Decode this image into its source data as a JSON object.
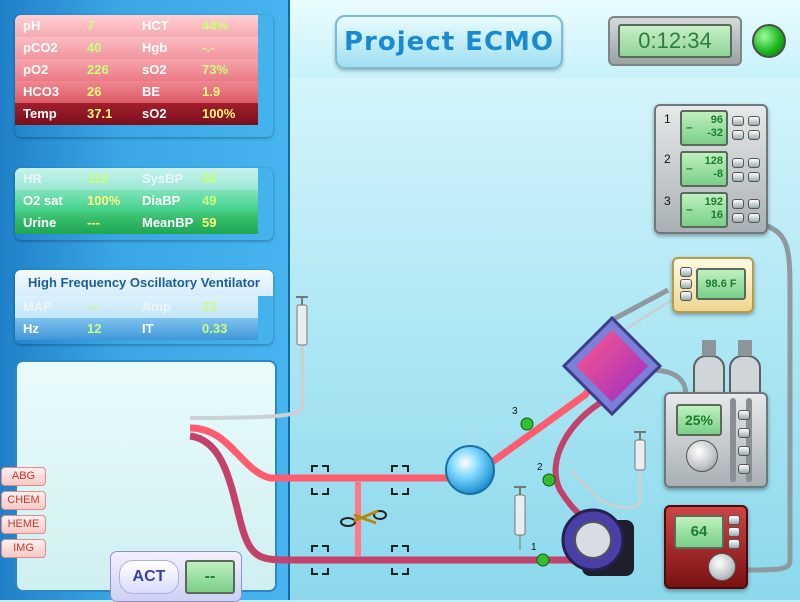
{
  "app": {
    "title": "Project ECMO",
    "timer": "0:12:34"
  },
  "blood_gas": [
    {
      "l1": "pH",
      "v1": "7",
      "l2": "HCT",
      "v2": "44%"
    },
    {
      "l1": "pCO2",
      "v1": "40",
      "l2": "Hgb",
      "v2": "-.-"
    },
    {
      "l1": "pO2",
      "v1": "226",
      "l2": "sO2",
      "v2": "73%"
    },
    {
      "l1": "HCO3",
      "v1": "26",
      "l2": "BE",
      "v2": "1.9"
    },
    {
      "l1": "Temp",
      "v1": "37.1",
      "l2": "sO2",
      "v2": "100%"
    }
  ],
  "vitals": [
    {
      "l1": "HR",
      "v1": "118",
      "l2": "SysBP",
      "v2": "68"
    },
    {
      "l1": "O2 sat",
      "v1": "100%",
      "l2": "DiaBP",
      "v2": "49"
    },
    {
      "l1": "Urine",
      "v1": "---",
      "l2": "MeanBP",
      "v2": "59"
    }
  ],
  "hfov": {
    "title": "High Frequency Oscillatory Ventilator",
    "rows": [
      {
        "l1": "MAP",
        "v1": "---",
        "l2": "Amp",
        "v2": "23"
      },
      {
        "l1": "Hz",
        "v1": "12",
        "l2": "IT",
        "v2": "0.33"
      }
    ]
  },
  "side_tabs": [
    "ABG",
    "CHEM",
    "HEME",
    "IMG"
  ],
  "act": {
    "label": "ACT",
    "value": "--"
  },
  "pressure_monitor": [
    {
      "index": "1",
      "top": "96",
      "bottom": "-32"
    },
    {
      "index": "2",
      "top": "128",
      "bottom": "-8"
    },
    {
      "index": "3",
      "top": "192",
      "bottom": "16"
    }
  ],
  "heater": {
    "value": "98.6 F"
  },
  "gas_blender": {
    "value": "25%"
  },
  "pump": {
    "value": "64"
  },
  "access_points": [
    "1",
    "2",
    "3"
  ],
  "colors": {
    "arterial": "#ff5c6f",
    "venous": "#c2426b",
    "status_led": "#1eb51e"
  }
}
